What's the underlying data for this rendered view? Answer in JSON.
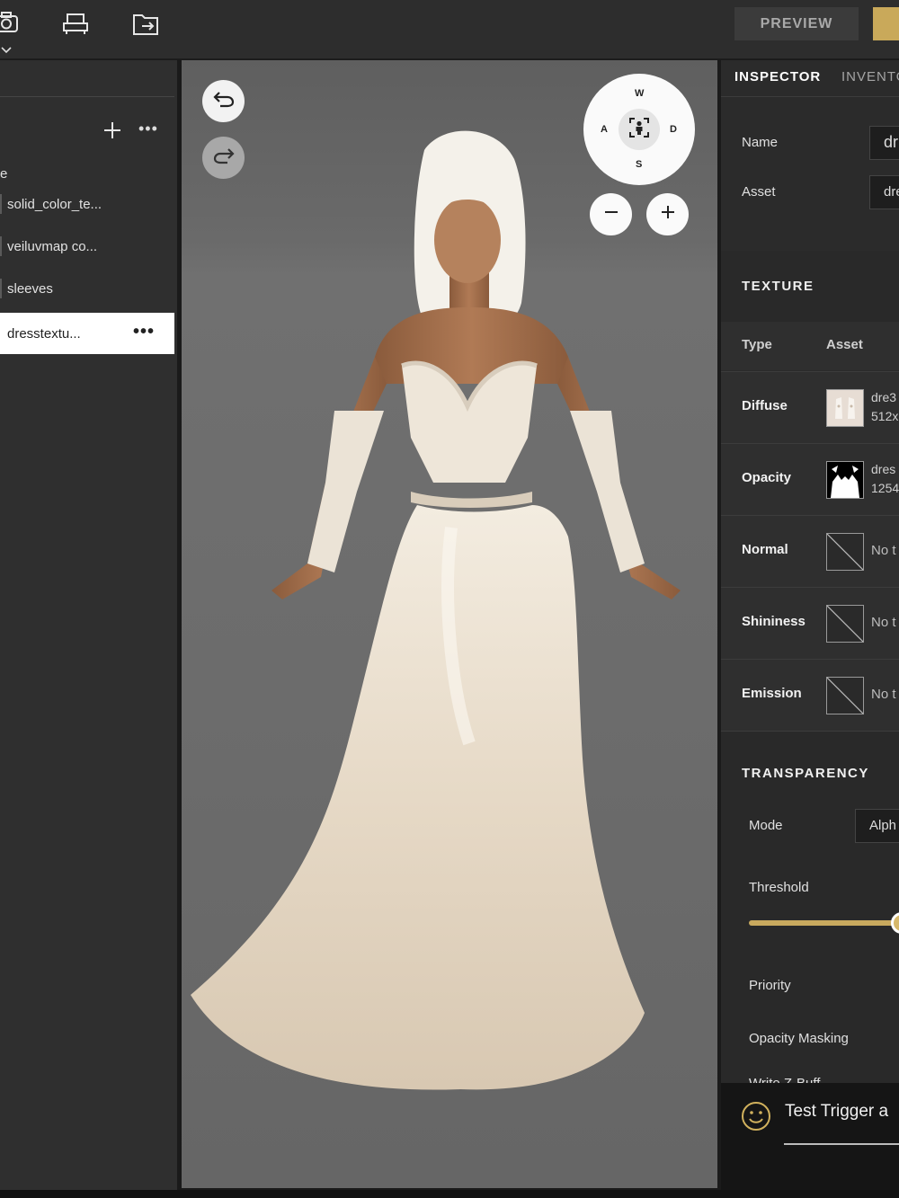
{
  "toolbar": {
    "preview_label": "PREVIEW",
    "icons": [
      "camera-icon",
      "chevron-down-icon",
      "chair-icon",
      "folder-export-icon"
    ]
  },
  "left_panel": {
    "partial_header": "e",
    "layers": [
      {
        "label": "solid_color_te...",
        "selected": false
      },
      {
        "label": "veiluvmap co...",
        "selected": false
      },
      {
        "label": "sleeves",
        "selected": false
      },
      {
        "label": "dresstextu...",
        "selected": true
      }
    ],
    "more_label": "•••"
  },
  "viewport": {
    "nav": {
      "up": "W",
      "down": "S",
      "left": "A",
      "right": "D"
    },
    "undo_icon": "undo-icon",
    "redo_icon": "redo-icon",
    "zoom_out_icon": "minus-icon",
    "zoom_in_icon": "plus-icon"
  },
  "inspector": {
    "tabs": [
      "INSPECTOR",
      "INVENTO"
    ],
    "name_label": "Name",
    "name_value": "dr",
    "asset_label": "Asset",
    "asset_value": "dre",
    "texture_title": "TEXTURE",
    "col_type": "Type",
    "col_asset": "Asset",
    "textures": [
      {
        "name": "Diffuse",
        "line1": "dre3",
        "line2": "512x"
      },
      {
        "name": "Opacity",
        "line1": "dres",
        "line2": "1254"
      },
      {
        "name": "Normal",
        "none": "No t"
      },
      {
        "name": "Shininess",
        "none": "No t"
      },
      {
        "name": "Emission",
        "none": "No t"
      }
    ],
    "transparency_title": "TRANSPARENCY",
    "mode_label": "Mode",
    "mode_value": "Alph",
    "threshold_label": "Threshold",
    "threshold_value": 1.0,
    "priority_label": "Priority",
    "opacity_masking_label": "Opacity Masking",
    "cut_label": "Write Z-Buff"
  },
  "trigger_bar": {
    "text": "Test Trigger a",
    "icon": "smiley-icon"
  },
  "colors": {
    "accent": "#c9a95a",
    "panel": "#2f2f2f",
    "viewport": "#6a6a6a"
  }
}
